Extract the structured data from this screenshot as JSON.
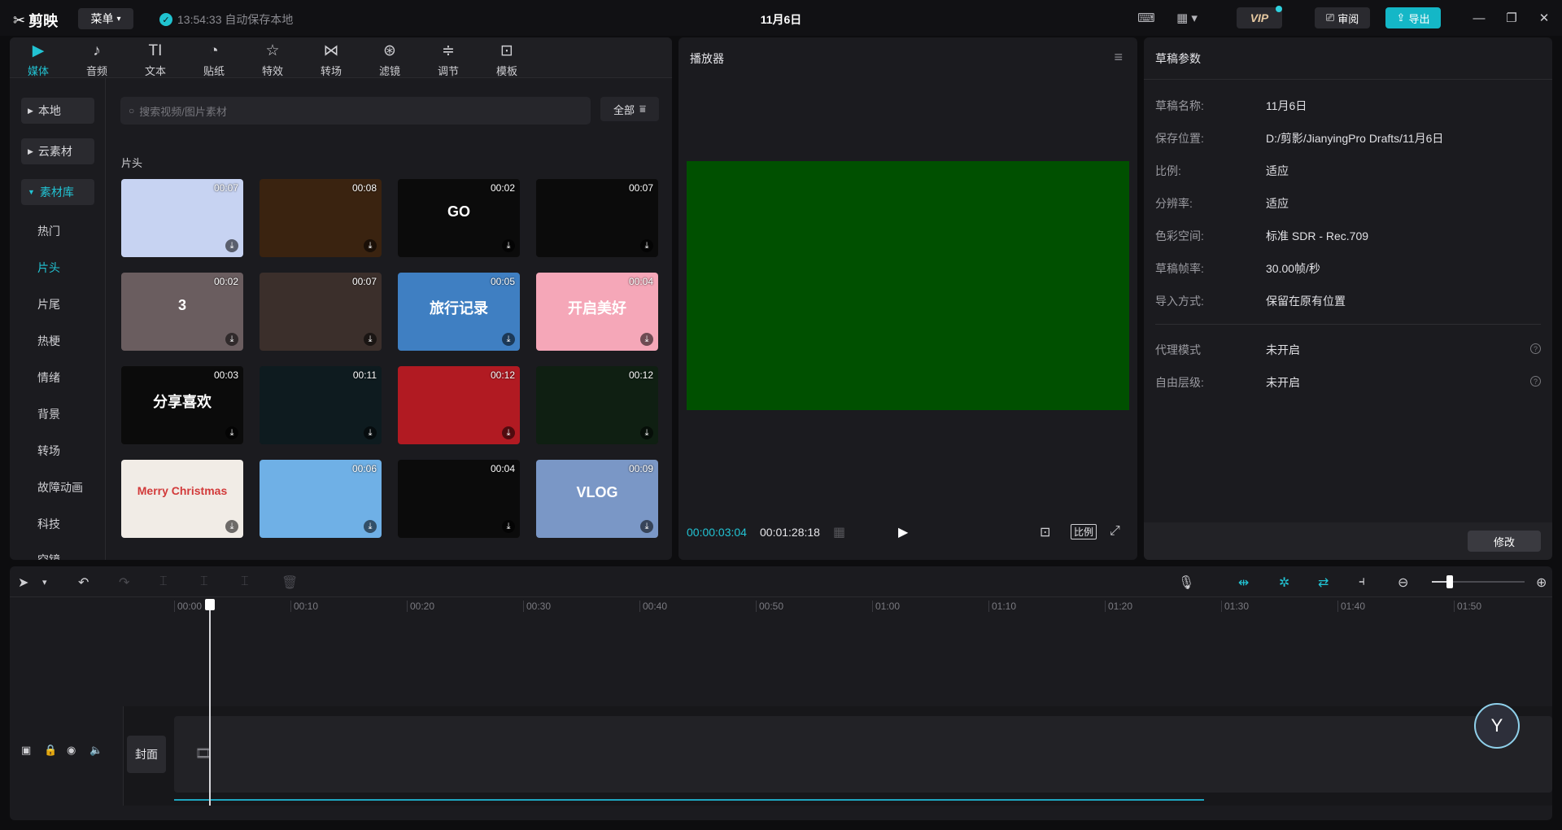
{
  "app": {
    "logo_text": "剪映",
    "menu_label": "菜单",
    "autosave": "13:54:33 自动保存本地",
    "project_title": "11月6日",
    "vip_label": "VIP",
    "review_label": "审阅",
    "export_label": "导出"
  },
  "media": {
    "tabs": [
      {
        "label": "媒体",
        "icon": "media-icon"
      },
      {
        "label": "音频",
        "icon": "audio-icon"
      },
      {
        "label": "文本",
        "icon": "text-icon"
      },
      {
        "label": "贴纸",
        "icon": "sticker-icon"
      },
      {
        "label": "特效",
        "icon": "effects-icon"
      },
      {
        "label": "转场",
        "icon": "transition-icon"
      },
      {
        "label": "滤镜",
        "icon": "filter-icon"
      },
      {
        "label": "调节",
        "icon": "adjust-icon"
      },
      {
        "label": "模板",
        "icon": "template-icon"
      }
    ],
    "groups": [
      "本地",
      "云素材",
      "素材库"
    ],
    "categories": [
      "热门",
      "片头",
      "片尾",
      "热梗",
      "情绪",
      "背景",
      "转场",
      "故障动画",
      "科技",
      "空镜"
    ],
    "search_placeholder": "搜索视频/图片素材",
    "filter_label": "全部",
    "section_label": "片头",
    "thumbs": [
      {
        "dur": "00:07",
        "caption": "",
        "color": "#c7d3f2"
      },
      {
        "dur": "00:08",
        "caption": "",
        "color": "#3a2310"
      },
      {
        "dur": "00:02",
        "caption": "GO",
        "color": "#0b0b0b"
      },
      {
        "dur": "00:07",
        "caption": "",
        "color": "#0b0b0b"
      },
      {
        "dur": "00:02",
        "caption": "3",
        "color": "#6a5d5f"
      },
      {
        "dur": "00:07",
        "caption": "",
        "color": "#3b2f2b"
      },
      {
        "dur": "00:05",
        "caption": "旅行记录",
        "color": "#3f7fc2"
      },
      {
        "dur": "00:04",
        "caption": "开启美好",
        "color": "#f5a7b8"
      },
      {
        "dur": "00:03",
        "caption": "分享喜欢",
        "color": "#0b0b0b"
      },
      {
        "dur": "00:11",
        "caption": "",
        "color": "#0e1b1f"
      },
      {
        "dur": "00:12",
        "caption": "",
        "color": "#b11a22"
      },
      {
        "dur": "00:12",
        "caption": "",
        "color": "#0f1f12"
      },
      {
        "dur": "",
        "caption": "Merry Christmas",
        "color": "#f1ece6"
      },
      {
        "dur": "00:06",
        "caption": "",
        "color": "#6fb0e6"
      },
      {
        "dur": "00:04",
        "caption": "",
        "color": "#0b0b0b"
      },
      {
        "dur": "00:09",
        "caption": "VLOG",
        "color": "#7a97c6"
      }
    ]
  },
  "player": {
    "title": "播放器",
    "current_time": "00:00:03:04",
    "total_time": "00:01:28:18",
    "ratio_label": "比例",
    "canvas_color": "#005000"
  },
  "props": {
    "title": "草稿参数",
    "rows": [
      {
        "label": "草稿名称:",
        "value": "11月6日"
      },
      {
        "label": "保存位置:",
        "value": "D:/剪影/JianyingPro Drafts/11月6日"
      },
      {
        "label": "比例:",
        "value": "适应"
      },
      {
        "label": "分辨率:",
        "value": "适应"
      },
      {
        "label": "色彩空间:",
        "value": "标准 SDR - Rec.709"
      },
      {
        "label": "草稿帧率:",
        "value": "30.00帧/秒"
      },
      {
        "label": "导入方式:",
        "value": "保留在原有位置"
      }
    ],
    "extra_rows": [
      {
        "label": "代理模式",
        "value": "未开启"
      },
      {
        "label": "自由层级:",
        "value": "未开启"
      }
    ],
    "modify_label": "修改"
  },
  "timeline": {
    "ticks": [
      "00:00",
      "00:10",
      "00:20",
      "00:30",
      "00:40",
      "00:50",
      "01:00",
      "01:10",
      "01:20",
      "01:30",
      "01:40",
      "01:50"
    ],
    "cover_label": "封面",
    "zoom_level": 0.2
  }
}
